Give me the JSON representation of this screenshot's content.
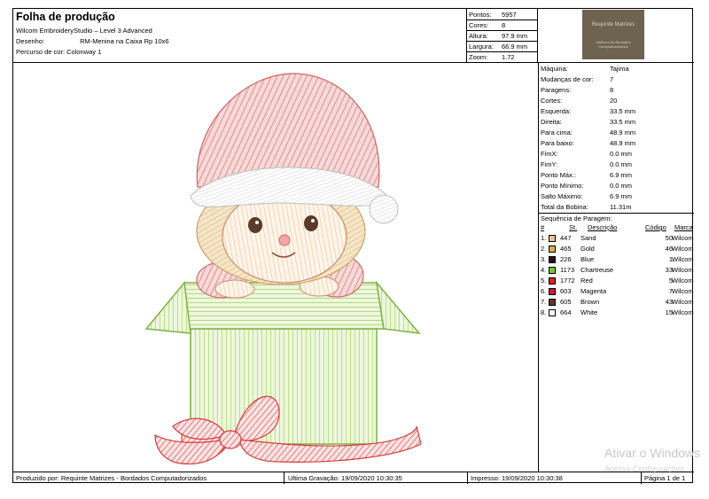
{
  "header": {
    "title": "Folha de produção",
    "info": [
      {
        "label": "Wilcom EmbroideryStudio – Level 3 Advanced",
        "value": ""
      },
      {
        "label": "Desenho:",
        "value": "RM-Menina na Caixa Rp 10x6"
      },
      {
        "label": "Percurso de cor:",
        "value": "Colonway 1"
      }
    ],
    "stats": [
      {
        "label": "Pontos:",
        "value": "5957"
      },
      {
        "label": "Cores:",
        "value": "8"
      },
      {
        "label": "Altura:",
        "value": "97.9 mm"
      },
      {
        "label": "Largura:",
        "value": "66.9 mm"
      },
      {
        "label": "Zoom:",
        "value": "1.72"
      }
    ],
    "logo_line1": "Requinte Matrizes",
    "logo_line2": "Matrizes de Bordados Computadorizados"
  },
  "machine_info": [
    {
      "label": "Máquina:",
      "value": "Tajima"
    },
    {
      "label": "Mudanças de cor:",
      "value": "7"
    },
    {
      "label": "Paragens:",
      "value": "8"
    },
    {
      "label": "Cortes:",
      "value": "20"
    },
    {
      "label": "Esquerda:",
      "value": "33.5 mm"
    },
    {
      "label": "Direita:",
      "value": "33.5 mm"
    },
    {
      "label": "Para cima:",
      "value": "48.9 mm"
    },
    {
      "label": "Para baixo:",
      "value": "48.9 mm"
    },
    {
      "label": "FimX:",
      "value": "0.0 mm"
    },
    {
      "label": "FimY:",
      "value": "0.0 mm"
    },
    {
      "label": "Ponto Máx.:",
      "value": "6.9 mm"
    },
    {
      "label": "Ponto Mínimo:",
      "value": "0.0 mm"
    },
    {
      "label": "Salto Máximo:",
      "value": "6.9 mm"
    },
    {
      "label": "Total da Bobina:",
      "value": "11.31m"
    }
  ],
  "sequence": {
    "title": "Sequência de Paragem:",
    "headers": {
      "num": "#",
      "st": "St.",
      "desc": "Descrição",
      "code": "Código",
      "brand": "Marca"
    },
    "rows": [
      {
        "num": "1.",
        "color": "#f2c39a",
        "st": "447",
        "desc": "Sand",
        "code": "50",
        "brand": "Wilcom"
      },
      {
        "num": "2.",
        "color": "#d9b04a",
        "st": "465",
        "desc": "Gold",
        "code": "46",
        "brand": "Wilcom"
      },
      {
        "num": "3.",
        "color": "#2a1010",
        "st": "226",
        "desc": "Blue",
        "code": "1",
        "brand": "Wilcom"
      },
      {
        "num": "4.",
        "color": "#7cc43a",
        "st": "1173",
        "desc": "Chartreuse",
        "code": "33",
        "brand": "Wilcom"
      },
      {
        "num": "5.",
        "color": "#e02020",
        "st": "1772",
        "desc": "Red",
        "code": "5",
        "brand": "Wilcom"
      },
      {
        "num": "6.",
        "color": "#c81e3c",
        "st": "603",
        "desc": "Magenta",
        "code": "7",
        "brand": "Wilcom"
      },
      {
        "num": "7.",
        "color": "#5a3a2a",
        "st": "605",
        "desc": "Brown",
        "code": "43",
        "brand": "Wilcom"
      },
      {
        "num": "8.",
        "color": "#ffffff",
        "st": "664",
        "desc": "White",
        "code": "15",
        "brand": "Wilcom"
      }
    ]
  },
  "footer": {
    "produced": "Produzido por: Requinte Matrizes - Bordados Computadorizados",
    "saved": "Ultima Gravação: 19/09/2020 10:30:35",
    "printed": "Impresso: 19/09/2020 10:30:38",
    "page": "Página 1 de 1"
  },
  "watermark": {
    "line1": "Ativar o Windows",
    "line2": "Acesse Configurações"
  }
}
